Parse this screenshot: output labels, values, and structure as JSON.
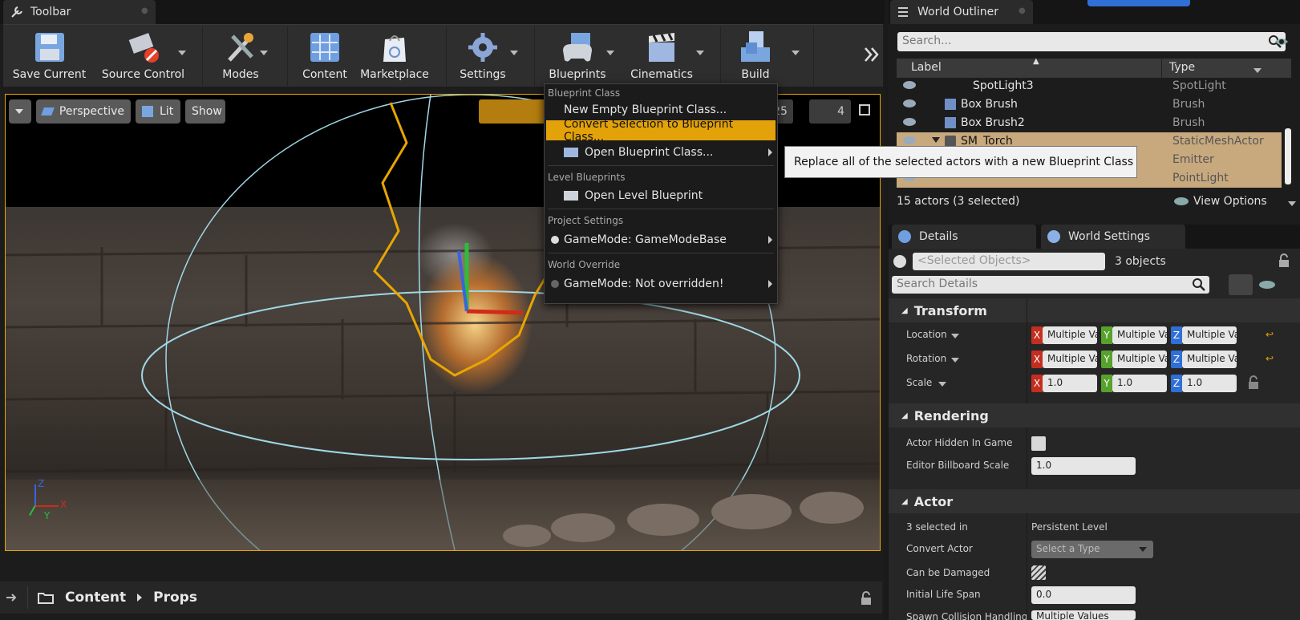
{
  "toolbar": {
    "tab_title": "Toolbar",
    "buttons": [
      {
        "label": "Save Current"
      },
      {
        "label": "Source Control"
      },
      {
        "label": "Modes"
      },
      {
        "label": "Content"
      },
      {
        "label": "Marketplace"
      },
      {
        "label": "Settings"
      },
      {
        "label": "Blueprints"
      },
      {
        "label": "Cinematics"
      },
      {
        "label": "Build"
      }
    ]
  },
  "viewport": {
    "perspective_label": "Perspective",
    "lit_label": "Lit",
    "show_label": "Show",
    "grid_value": "25",
    "camera_speed": "4",
    "axis_x": "X",
    "axis_y": "Y",
    "axis_z": "Z"
  },
  "blueprint_menu": {
    "section_blueprint_class": "Blueprint Class",
    "new_empty": "New Empty Blueprint Class...",
    "convert_selection": "Convert Selection to Blueprint Class...",
    "open_blueprint": "Open Blueprint Class...",
    "section_level": "Level Blueprints",
    "open_level": "Open Level Blueprint",
    "section_project": "Project Settings",
    "gamemode_project": "GameMode: GameModeBase",
    "section_world": "World Override",
    "gamemode_world": "GameMode: Not overridden!"
  },
  "tooltip": {
    "text": "Replace all of the selected actors with a new Blueprint Class"
  },
  "content_browser": {
    "crumb_content": "Content",
    "crumb_props": "Props"
  },
  "outliner": {
    "tab_title": "World Outliner",
    "search_placeholder": "Search...",
    "col_label": "Label",
    "col_type": "Type",
    "rows": [
      {
        "name": "SpotLight3",
        "type": "SpotLight"
      },
      {
        "name": "Box Brush",
        "type": "Brush"
      },
      {
        "name": "Box Brush2",
        "type": "Brush"
      },
      {
        "name": "SM_Torch",
        "type": "StaticMeshActor"
      },
      {
        "name": "",
        "type": "Emitter"
      },
      {
        "name": "",
        "type": "PointLight"
      }
    ],
    "footer_count": "15 actors (3 selected)",
    "view_options": "View Options"
  },
  "details": {
    "tab_details": "Details",
    "tab_world_settings": "World Settings",
    "selected_placeholder": "<Selected Objects>",
    "objects_count": "3 objects",
    "search_placeholder": "Search Details",
    "transform": {
      "title": "Transform",
      "location_label": "Location",
      "rotation_label": "Rotation",
      "scale_label": "Scale",
      "multiple": "Multiple Va",
      "scale_x": "1.0",
      "scale_y": "1.0",
      "scale_z": "1.0"
    },
    "rendering": {
      "title": "Rendering",
      "hidden_label": "Actor Hidden In Game",
      "billboard_label": "Editor Billboard Scale",
      "billboard_value": "1.0"
    },
    "actor": {
      "title": "Actor",
      "selected_in_label": "3 selected in",
      "selected_in_value": "Persistent Level",
      "convert_label": "Convert Actor",
      "convert_value": "Select a Type",
      "damaged_label": "Can be Damaged",
      "lifespan_label": "Initial Life Span",
      "lifespan_value": "0.0",
      "spawn_label": "Spawn Collision Handling M",
      "spawn_value": "Multiple Values"
    }
  },
  "colors": {
    "accent_orange": "#e3a20a",
    "selection_tan": "#c8a97e",
    "axis_x": "#c42e1f",
    "axis_y": "#56a22c",
    "axis_z": "#2f6fd6"
  }
}
